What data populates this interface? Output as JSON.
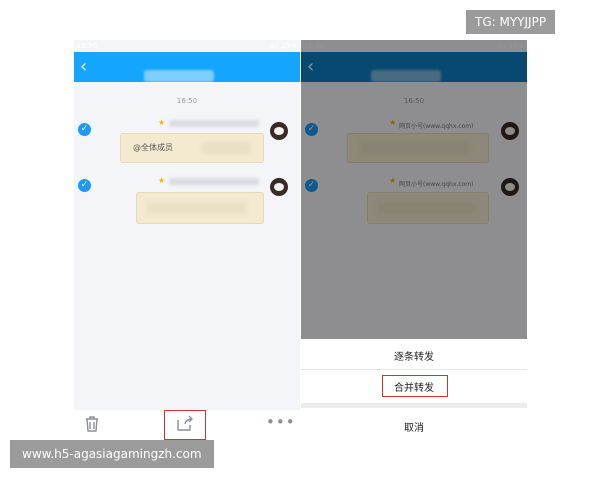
{
  "status_time": "16:50",
  "status_right": "4G 29%",
  "chat": {
    "timestamp": "16:50",
    "left_message_text": "@全体成员",
    "right_nick_1": "网页小号(www.qqhx.com)",
    "right_nick_2": "网页小号(www.qqhx.com)"
  },
  "action_sheet": {
    "item_one_by_one": "逐条转发",
    "item_merge": "合并转发",
    "cancel": "取消"
  },
  "toolbar": {
    "delete_icon": "trash-icon",
    "forward_icon": "share-icon",
    "more_icon": "more-icon"
  },
  "watermarks": {
    "top": "TG: MYYJJPP",
    "bottom": "www.h5-agasiagamingzh.com"
  },
  "colors": {
    "accent": "#14a6ff",
    "highlight": "#d63030"
  }
}
